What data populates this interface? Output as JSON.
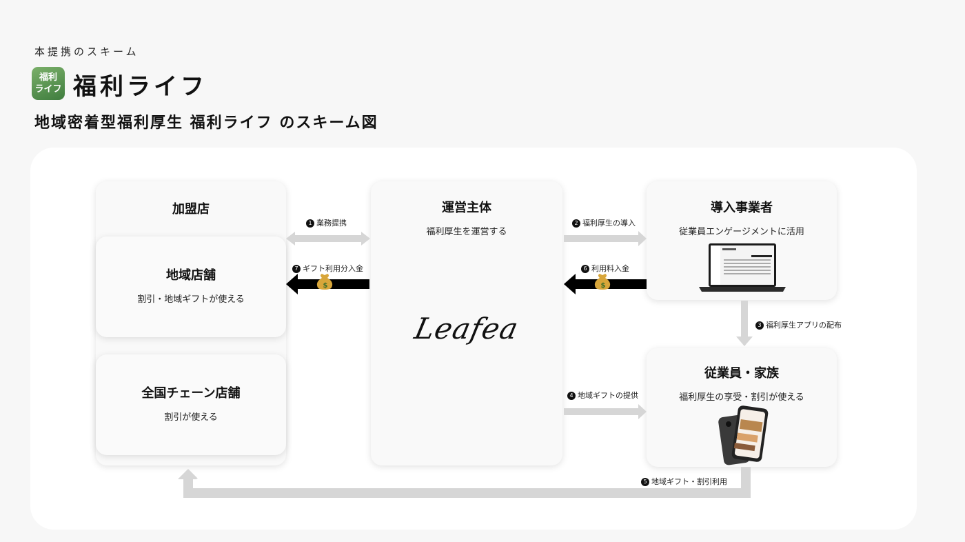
{
  "header": {
    "kicker": "本提携のスキーム",
    "logo_line1": "福利",
    "logo_line2": "ライフ",
    "brand": "福利ライフ",
    "subtitle": "地域密着型福利厚生 福利ライフ のスキーム図"
  },
  "boxes": {
    "member_stores": {
      "title": "加盟店"
    },
    "local_stores": {
      "title": "地域店舗",
      "desc": "割引・地域ギフトが使える"
    },
    "chain_stores": {
      "title": "全国チェーン店舗",
      "desc": "割引が使える"
    },
    "operator": {
      "title": "運営主体",
      "desc": "福利厚生を運営する",
      "logo_text": "Leafea"
    },
    "adopters": {
      "title": "導入事業者",
      "desc": "従業員エンゲージメントに活用"
    },
    "employees": {
      "title": "従業員・家族",
      "desc": "福利厚生の享受・割引が使える"
    }
  },
  "arrows": [
    {
      "num": "1",
      "label": "業務提携"
    },
    {
      "num": "2",
      "label": "福利厚生の導入"
    },
    {
      "num": "3",
      "label": "福利厚生アプリの配布"
    },
    {
      "num": "4",
      "label": "地域ギフトの提供"
    },
    {
      "num": "5",
      "label": "地域ギフト・割引利用"
    },
    {
      "num": "6",
      "label": "利用料入金"
    },
    {
      "num": "7",
      "label": "ギフト利用分入金"
    }
  ],
  "colors": {
    "arrow_gray": "#d6d6d6",
    "arrow_black": "#000000",
    "logo_green": "#4f8c48"
  },
  "icons": {
    "money_bag": "money-bag-icon",
    "laptop": "laptop-icon",
    "phone": "smartphone-icon"
  }
}
